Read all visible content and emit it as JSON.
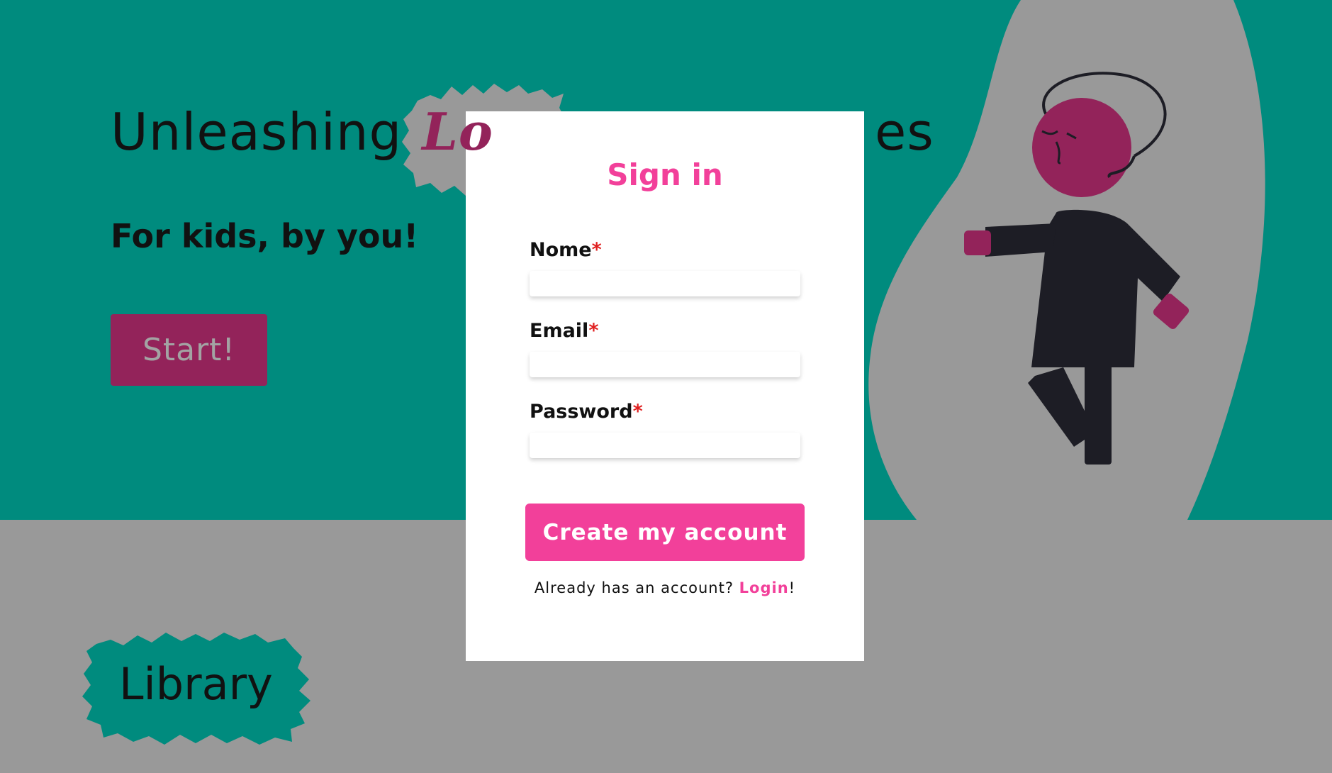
{
  "hero": {
    "title_before": "Unleashing",
    "title_highlight": "Lo",
    "title_after": "es",
    "subtitle": "For kids, by you!",
    "start_button": "Start!"
  },
  "library": {
    "title": "Library"
  },
  "signin": {
    "title": "Sign in",
    "fields": [
      {
        "label": "Nome",
        "required_mark": "*",
        "value": ""
      },
      {
        "label": "Email",
        "required_mark": "*",
        "value": ""
      },
      {
        "label": "Password",
        "required_mark": "*",
        "value": ""
      }
    ],
    "submit_label": "Create my account",
    "login_prompt": "Already has an account? ",
    "login_link": "Login",
    "login_suffix": "!"
  },
  "colors": {
    "teal": "#008b7e",
    "gray": "#999999",
    "magenta": "#93235a",
    "pink": "#f2409a",
    "dark": "#1d1d25",
    "required": "#e02020"
  }
}
